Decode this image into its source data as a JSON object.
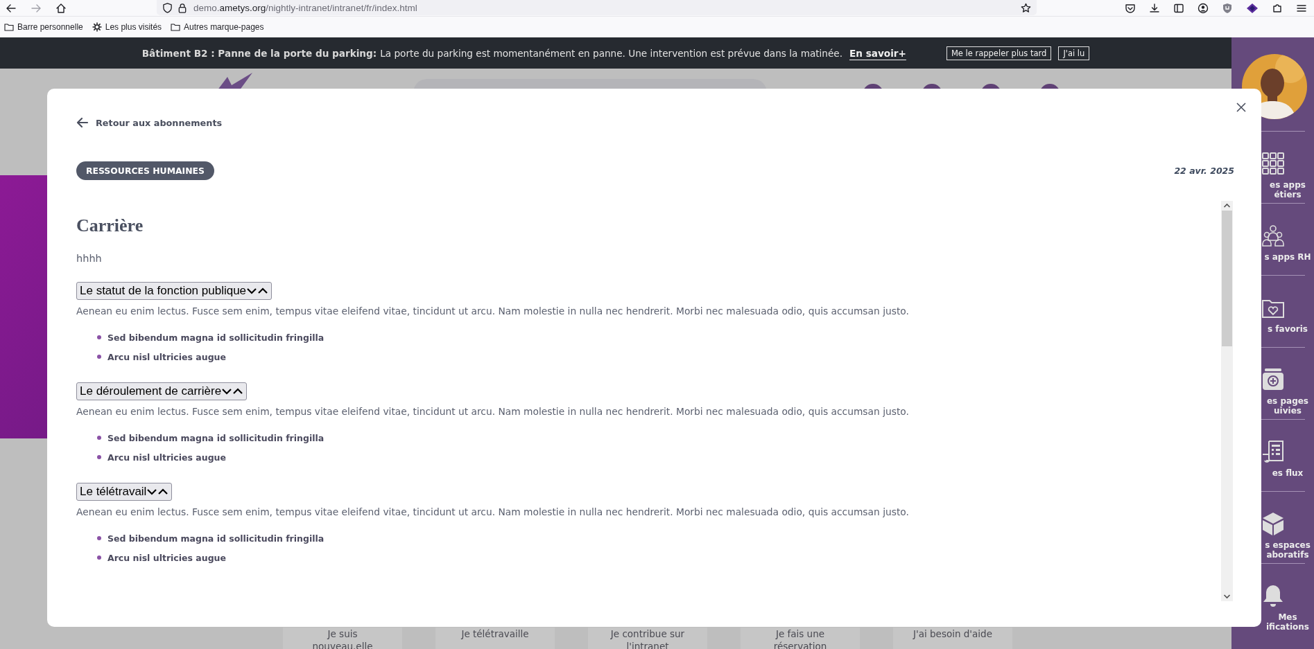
{
  "browser": {
    "url": {
      "prefix": "demo.",
      "domain": "ametys.org",
      "path": "/nightly-intranet/intranet/fr/index.html"
    },
    "bookmarks": [
      {
        "kind": "folder",
        "label": "Barre personnelle"
      },
      {
        "kind": "gear",
        "label": "Les plus visités"
      },
      {
        "kind": "folder",
        "label": "Autres marque-pages"
      }
    ]
  },
  "banner": {
    "title": "Bâtiment B2 : Panne de la porte du parking:",
    "message": "La porte du parking est momentanément en panne. Une intervention est prévue dans la matinée.",
    "link": "En savoir+",
    "buttons": [
      "Me le rappeler plus tard",
      "J'ai lu"
    ]
  },
  "tiles": [
    {
      "lines": [
        "Je suis",
        "nouveau.elle"
      ]
    },
    {
      "lines": [
        "Je télétravaille"
      ]
    },
    {
      "lines": [
        "Je contribue sur",
        "l'intranet"
      ]
    },
    {
      "lines": [
        "Je fais une",
        "réservation"
      ]
    },
    {
      "lines": [
        "J'ai besoin d'aide"
      ]
    }
  ],
  "sidebar": {
    "items": [
      {
        "kind": "grid",
        "lines": [
          "es apps",
          "étiers"
        ]
      },
      {
        "kind": "people",
        "lines": [
          "s apps RH"
        ]
      },
      {
        "kind": "folder-heart",
        "lines": [
          "s favoris"
        ]
      },
      {
        "kind": "tray-plus",
        "lines": [
          "es pages",
          "uivies"
        ]
      },
      {
        "kind": "newspaper",
        "lines": [
          "es flux"
        ]
      },
      {
        "kind": "cube",
        "lines": [
          "s espaces",
          "aboratifs"
        ]
      },
      {
        "kind": "bell",
        "lines": [
          "Mes",
          "ifications"
        ]
      }
    ]
  },
  "modal": {
    "back_link": "Retour aux abonnements",
    "category": "RESSOURCES HUMAINES",
    "date": "22 avr. 2025",
    "title": "Carrière",
    "intro": "hhhh",
    "sections": [
      {
        "title": "Le statut de la fonction publique",
        "text": "Aenean eu enim lectus. Fusce sem enim, tempus vitae eleifend vitae, tincidunt ut arcu. Nam molestie in nulla nec hendrerit. Morbi nec malesuada odio, quis accumsan justo.",
        "bullets": [
          "Sed bibendum magna id sollicitudin fringilla",
          "Arcu nisl ultricies augue"
        ]
      },
      {
        "title": "Le déroulement de carrière",
        "text": "Aenean eu enim lectus. Fusce sem enim, tempus vitae eleifend vitae, tincidunt ut arcu. Nam molestie in nulla nec hendrerit. Morbi nec malesuada odio, quis accumsan justo.",
        "bullets": [
          "Sed bibendum magna id sollicitudin fringilla",
          "Arcu nisl ultricies augue"
        ]
      },
      {
        "title": "Le télétravail",
        "text": "Aenean eu enim lectus. Fusce sem enim, tempus vitae eleifend vitae, tincidunt ut arcu. Nam molestie in nulla nec hendrerit. Morbi nec malesuada odio, quis accumsan justo.",
        "bullets": [
          "Sed bibendum magna id sollicitudin fringilla",
          "Arcu nisl ultricies augue"
        ]
      }
    ]
  }
}
